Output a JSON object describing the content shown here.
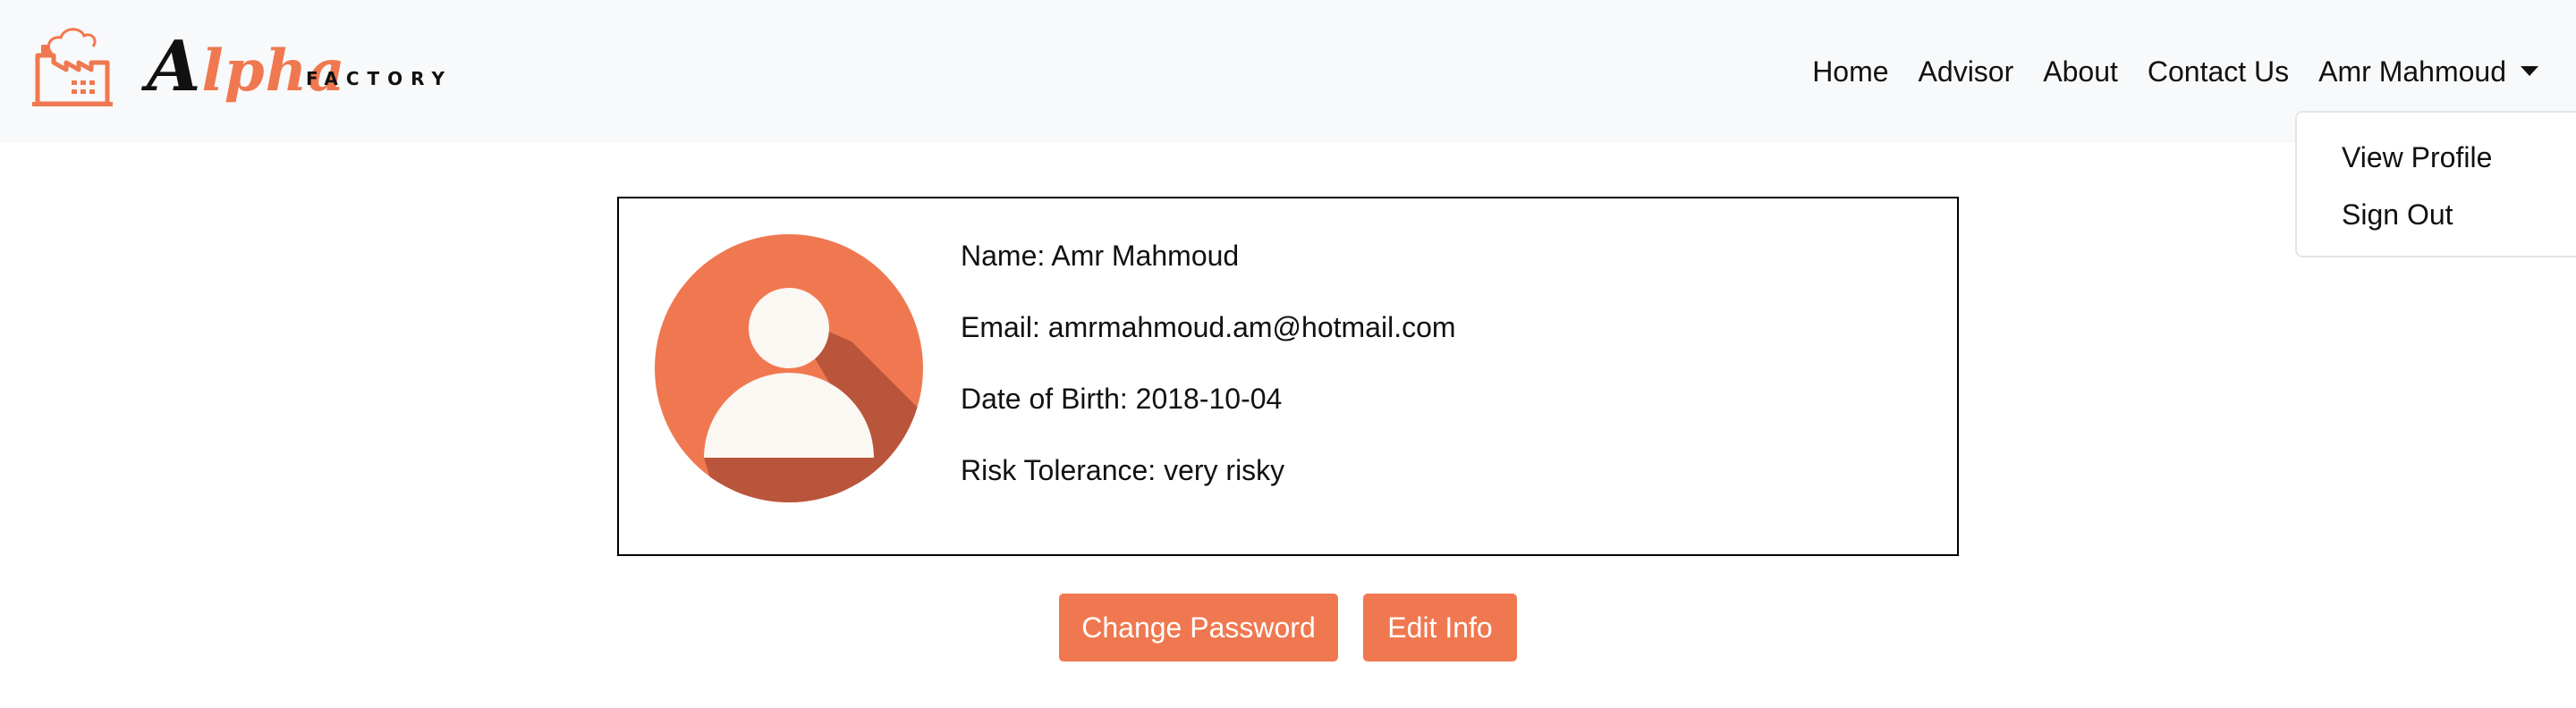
{
  "brand": {
    "logo_prefix": "A",
    "logo_rest": "lpha",
    "logo_suffix": "FACTORY",
    "logo_icon": "factory-icon",
    "accent_color": "#f07850"
  },
  "nav": {
    "items": [
      {
        "label": "Home"
      },
      {
        "label": "Advisor"
      },
      {
        "label": "About"
      },
      {
        "label": "Contact Us"
      }
    ],
    "user_menu_label": "Amr Mahmoud",
    "dropdown": {
      "items": [
        {
          "label": "View Profile"
        },
        {
          "label": "Sign Out"
        }
      ]
    }
  },
  "profile": {
    "avatar_icon": "user-avatar-icon",
    "name_line": "Name: Amr Mahmoud",
    "email_line": "Email: amrmahmoud.am@hotmail.com",
    "dob_line": "Date of Birth: 2018-10-04",
    "risk_line": "Risk Tolerance: very risky"
  },
  "actions": {
    "change_password_label": "Change Password",
    "edit_info_label": "Edit Info"
  }
}
